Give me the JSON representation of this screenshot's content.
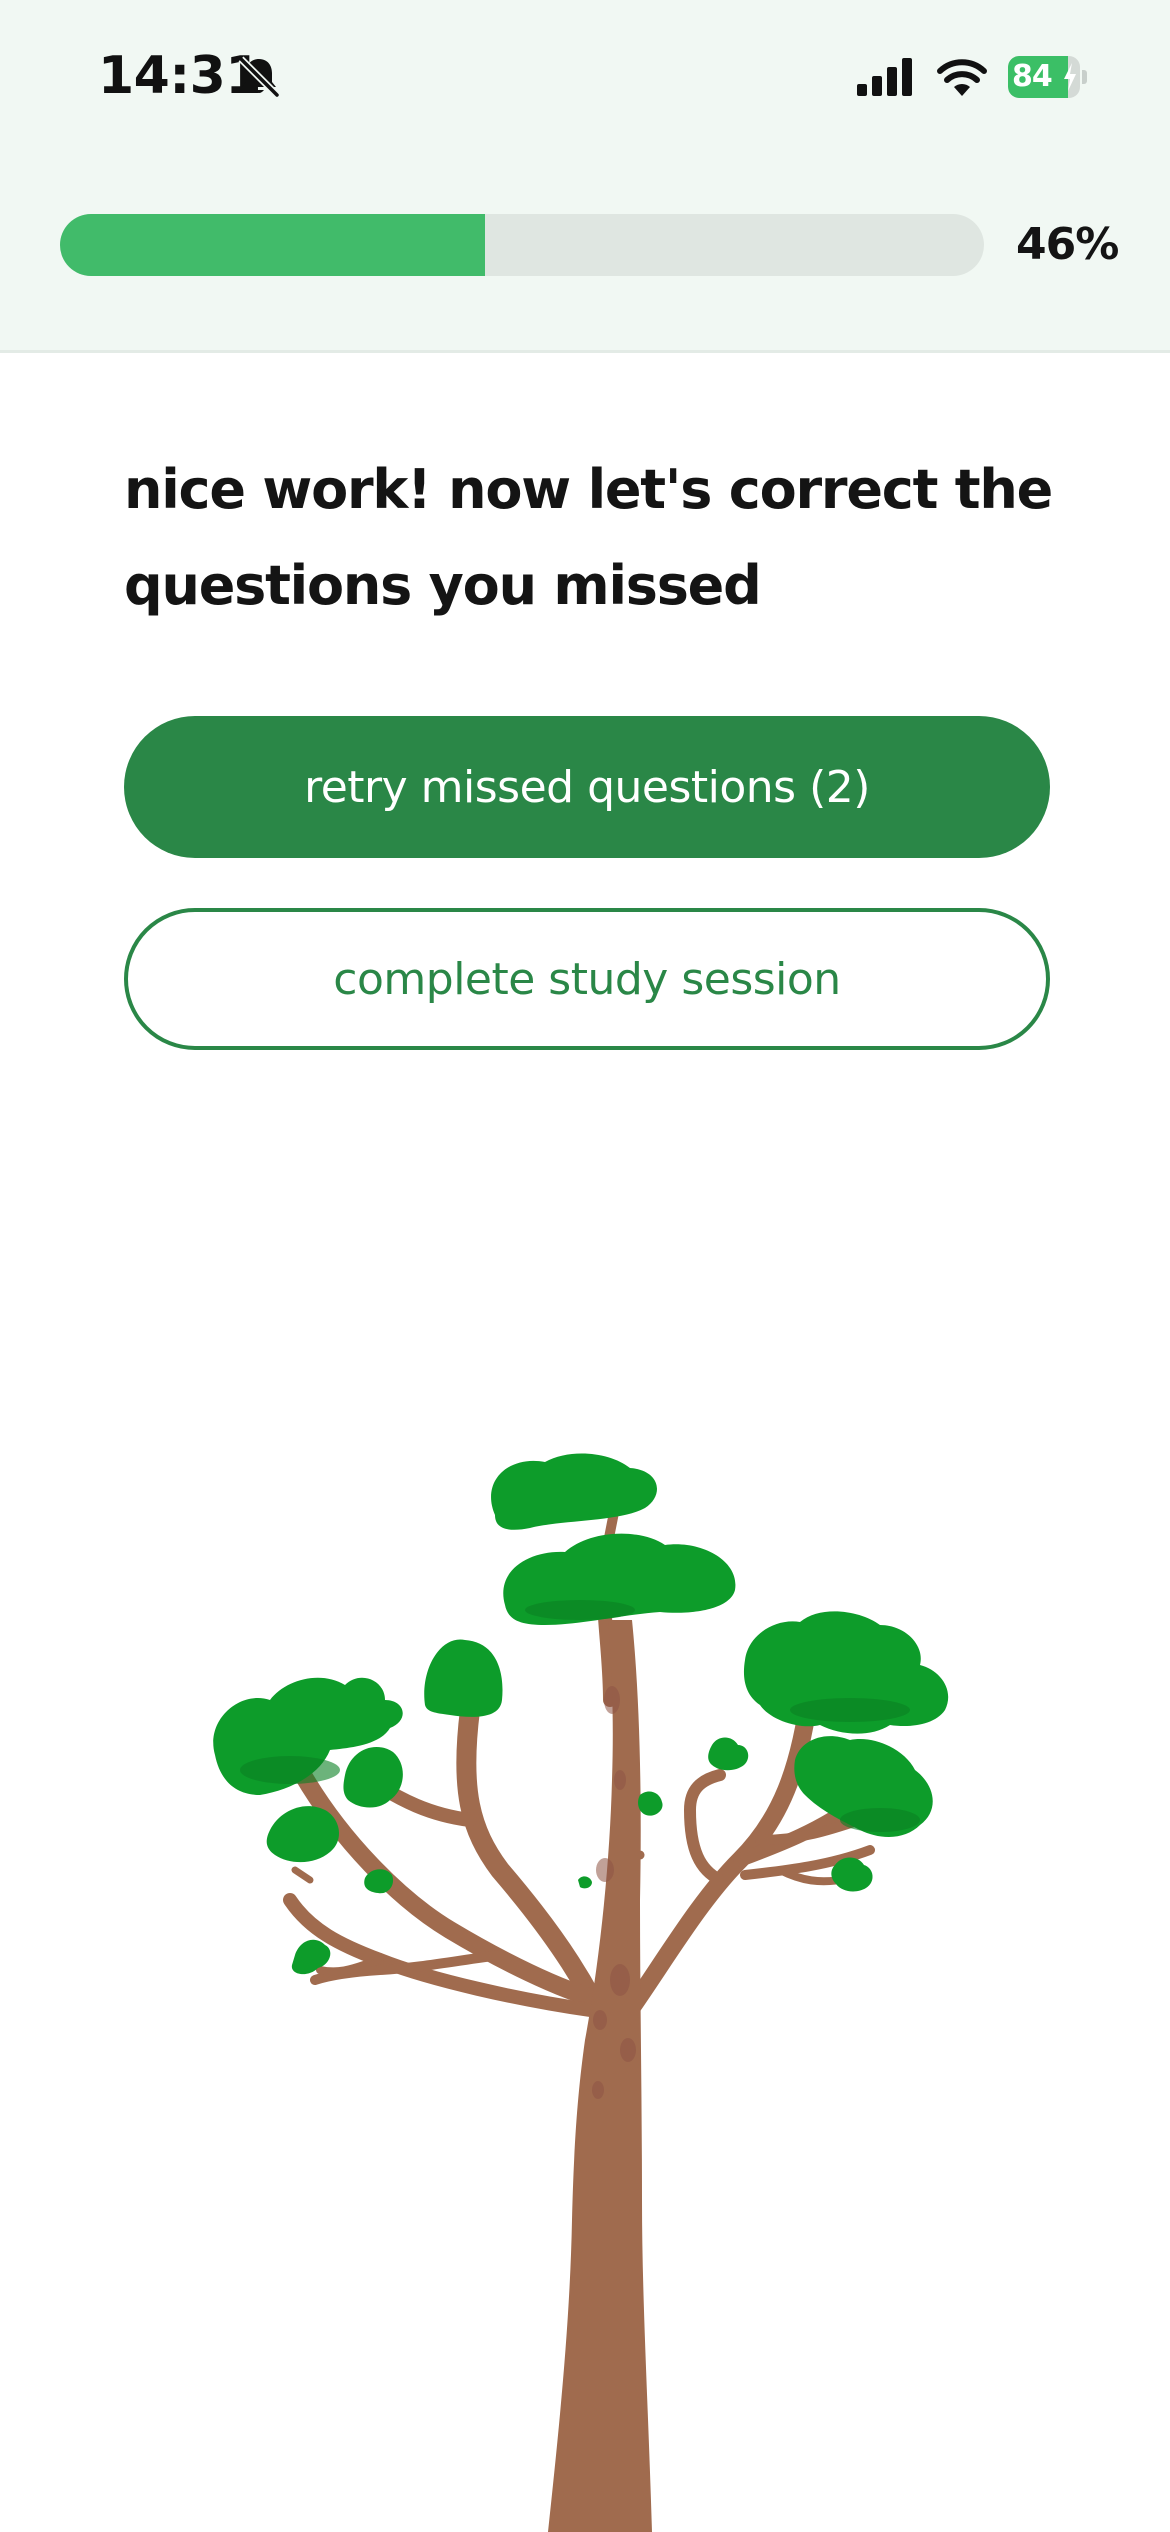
{
  "status_bar": {
    "time": "14:31",
    "battery_percent": "84",
    "battery_level": 0.84,
    "icons": [
      "bell-slash-icon",
      "cellular-signal-icon",
      "wifi-icon",
      "battery-charging-icon"
    ]
  },
  "progress": {
    "value": 0.46,
    "label": "46%"
  },
  "headline": "nice work! now let's correct the questions you missed",
  "buttons": {
    "retry_label": "retry missed questions (2)",
    "complete_label": "complete study session"
  },
  "illustration": {
    "icon": "tree-illustration"
  },
  "colors": {
    "primary": "#2a8747",
    "progress_fill": "#41bb6a",
    "progress_track": "#dfe6e1",
    "header_bg": "#f1f8f3",
    "leaf": "#0d9c2a",
    "trunk": "#a06b4e"
  }
}
